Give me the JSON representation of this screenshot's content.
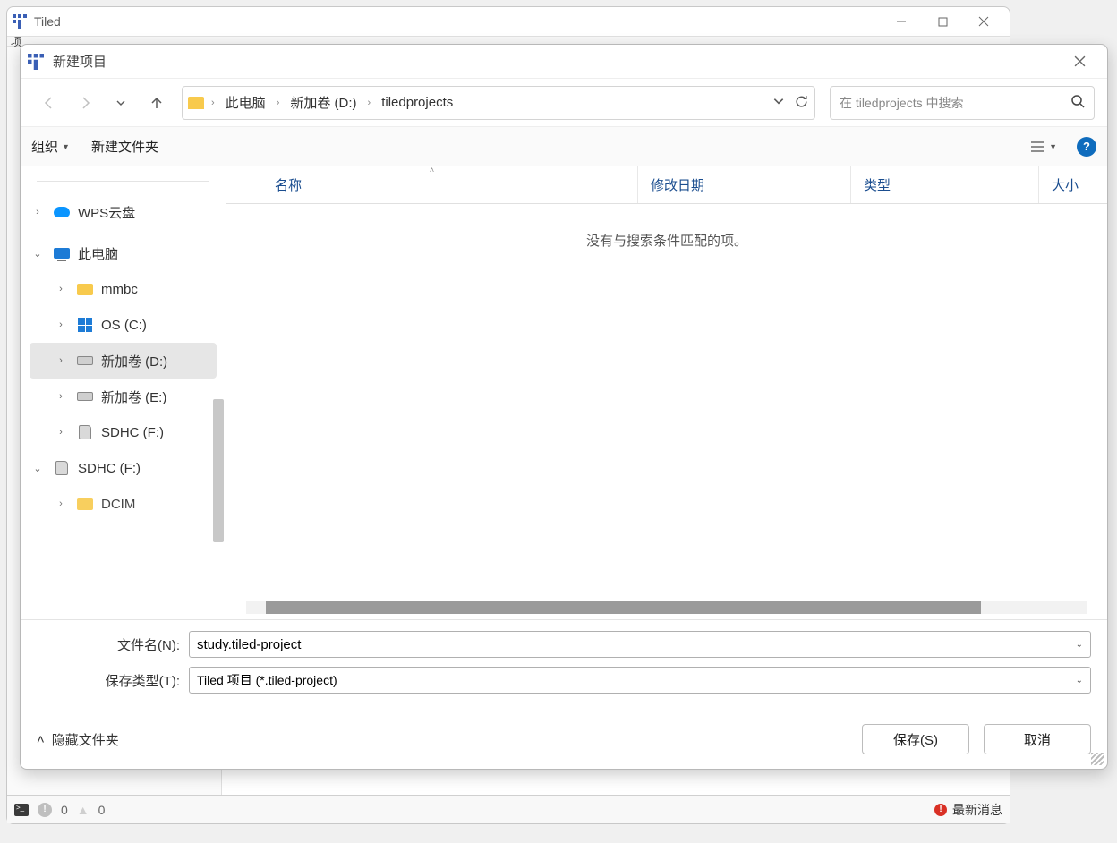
{
  "mainWindow": {
    "title": "Tiled",
    "menuHint": "项"
  },
  "statusbar": {
    "error_count": "0",
    "warn_count": "0",
    "latest_label": "最新消息"
  },
  "dialog": {
    "title": "新建项目",
    "breadcrumb": {
      "root": "此电脑",
      "mid": "新加卷 (D:)",
      "leaf": "tiledprojects"
    },
    "search_placeholder": "在 tiledprojects 中搜索",
    "toolbar": {
      "organize": "组织",
      "new_folder": "新建文件夹"
    },
    "columns": {
      "name": "名称",
      "date": "修改日期",
      "type": "类型",
      "size": "大小"
    },
    "empty_msg": "没有与搜索条件匹配的项。",
    "tree": {
      "wps": "WPS云盘",
      "thispc": "此电脑",
      "mmbc": "mmbc",
      "osc": "OS (C:)",
      "d": "新加卷 (D:)",
      "e": "新加卷 (E:)",
      "sdf1": "SDHC (F:)",
      "sdf2": "SDHC (F:)",
      "dcim": "DCIM"
    },
    "form": {
      "filename_label": "文件名(N):",
      "filename_value": "study.tiled-project",
      "savetype_label": "保存类型(T):",
      "savetype_value": "Tiled 项目 (*.tiled-project)"
    },
    "hide_folders": "隐藏文件夹",
    "save_btn": "保存(S)",
    "cancel_btn": "取消"
  }
}
